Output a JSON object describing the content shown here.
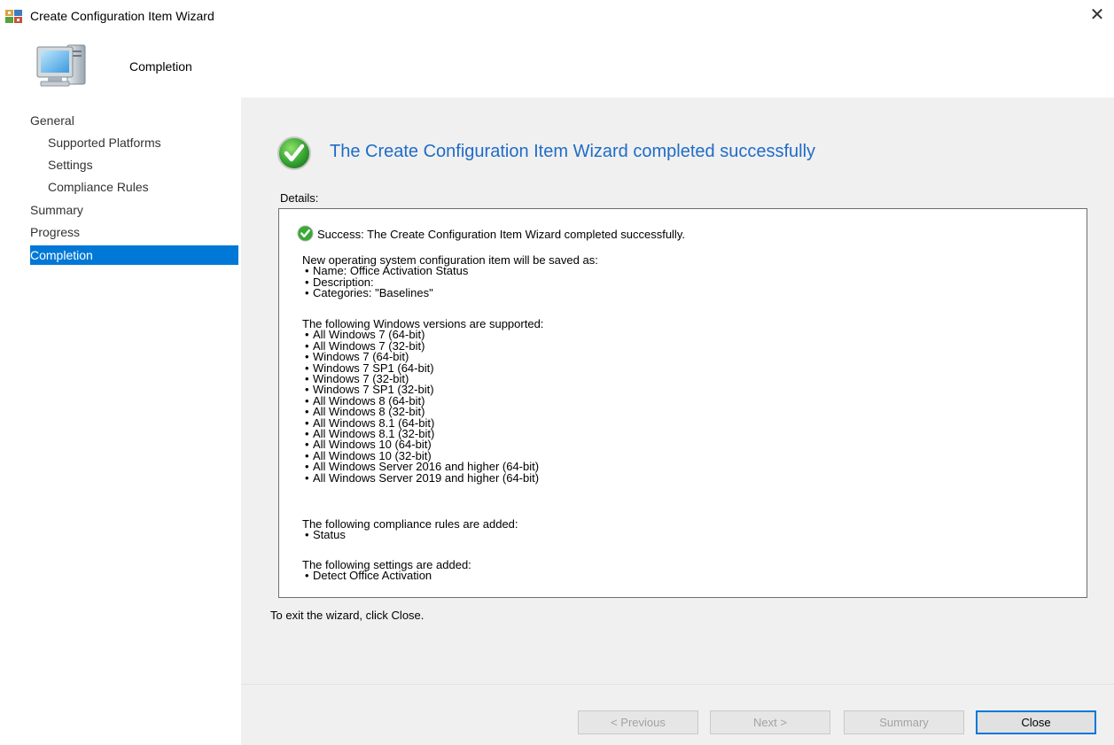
{
  "window": {
    "title": "Create Configuration Item Wizard",
    "close_glyph": "✕",
    "header_title": "Completion"
  },
  "sidebar": {
    "items": [
      {
        "label": "General",
        "level": 0,
        "active": false
      },
      {
        "label": "Supported Platforms",
        "level": 1,
        "active": false
      },
      {
        "label": "Settings",
        "level": 1,
        "active": false
      },
      {
        "label": "Compliance Rules",
        "level": 1,
        "active": false
      },
      {
        "label": "Summary",
        "level": 0,
        "active": false
      },
      {
        "label": "Progress",
        "level": 0,
        "active": false
      },
      {
        "label": "Completion",
        "level": 0,
        "active": true
      }
    ]
  },
  "main": {
    "heading": "The Create Configuration Item Wizard completed successfully",
    "details_label": "Details:",
    "success_line": "Success: The Create Configuration Item Wizard completed successfully.",
    "saved_block": {
      "head": "New operating system configuration item will be saved as:",
      "items": [
        "Name: Office Activation Status",
        "Description:",
        "Categories: \"Baselines\""
      ]
    },
    "versions_block": {
      "head": "The following Windows versions are supported:",
      "items": [
        "All Windows 7 (64-bit)",
        "All Windows 7 (32-bit)",
        "Windows 7 (64-bit)",
        "Windows 7 SP1 (64-bit)",
        "Windows 7 (32-bit)",
        "Windows 7 SP1 (32-bit)",
        "All Windows 8 (64-bit)",
        "All Windows 8 (32-bit)",
        "All Windows 8.1 (64-bit)",
        "All Windows 8.1 (32-bit)",
        "All Windows 10 (64-bit)",
        "All Windows 10 (32-bit)",
        "All Windows Server 2016 and higher (64-bit)",
        "All Windows Server 2019 and higher (64-bit)"
      ]
    },
    "rules_block": {
      "head": "The following compliance rules are added:",
      "items": [
        "Status"
      ]
    },
    "settings_block": {
      "head": "The following settings are added:",
      "items": [
        "Detect Office Activation"
      ]
    },
    "exit_text": "To exit the wizard, click Close."
  },
  "buttons": {
    "previous": "< Previous",
    "next": "Next >",
    "summary": "Summary",
    "close": "Close"
  },
  "colors": {
    "accent": "#0078d7",
    "heading": "#1f6cc7",
    "panel_bg": "#f0f0f0",
    "success_green": "#3aa935"
  }
}
